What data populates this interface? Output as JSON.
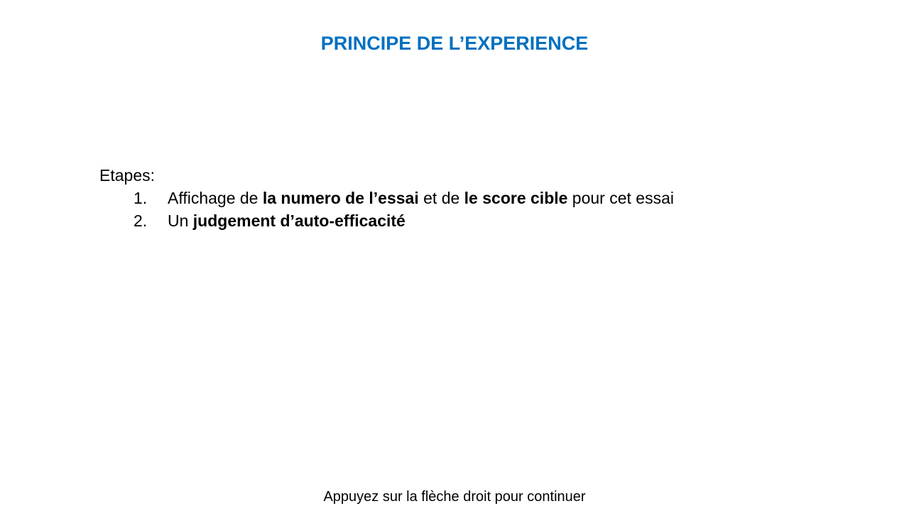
{
  "slide": {
    "title": "PRINCIPE DE L’EXPERIENCE",
    "steps_heading": "Etapes:",
    "steps": [
      {
        "number": "1.",
        "part1": "Affichage de ",
        "bold1": "la numero de l’essai",
        "part2": " et de ",
        "bold2": "le score cible",
        "part3": " pour cet essai"
      },
      {
        "number": "2.",
        "part1": "Un ",
        "bold1": "judgement d’auto-efficacité"
      }
    ],
    "footer": "Appuyez sur la flèche droit pour continuer"
  },
  "colors": {
    "title": "#0070C0",
    "text": "#000000",
    "background": "#ffffff"
  }
}
